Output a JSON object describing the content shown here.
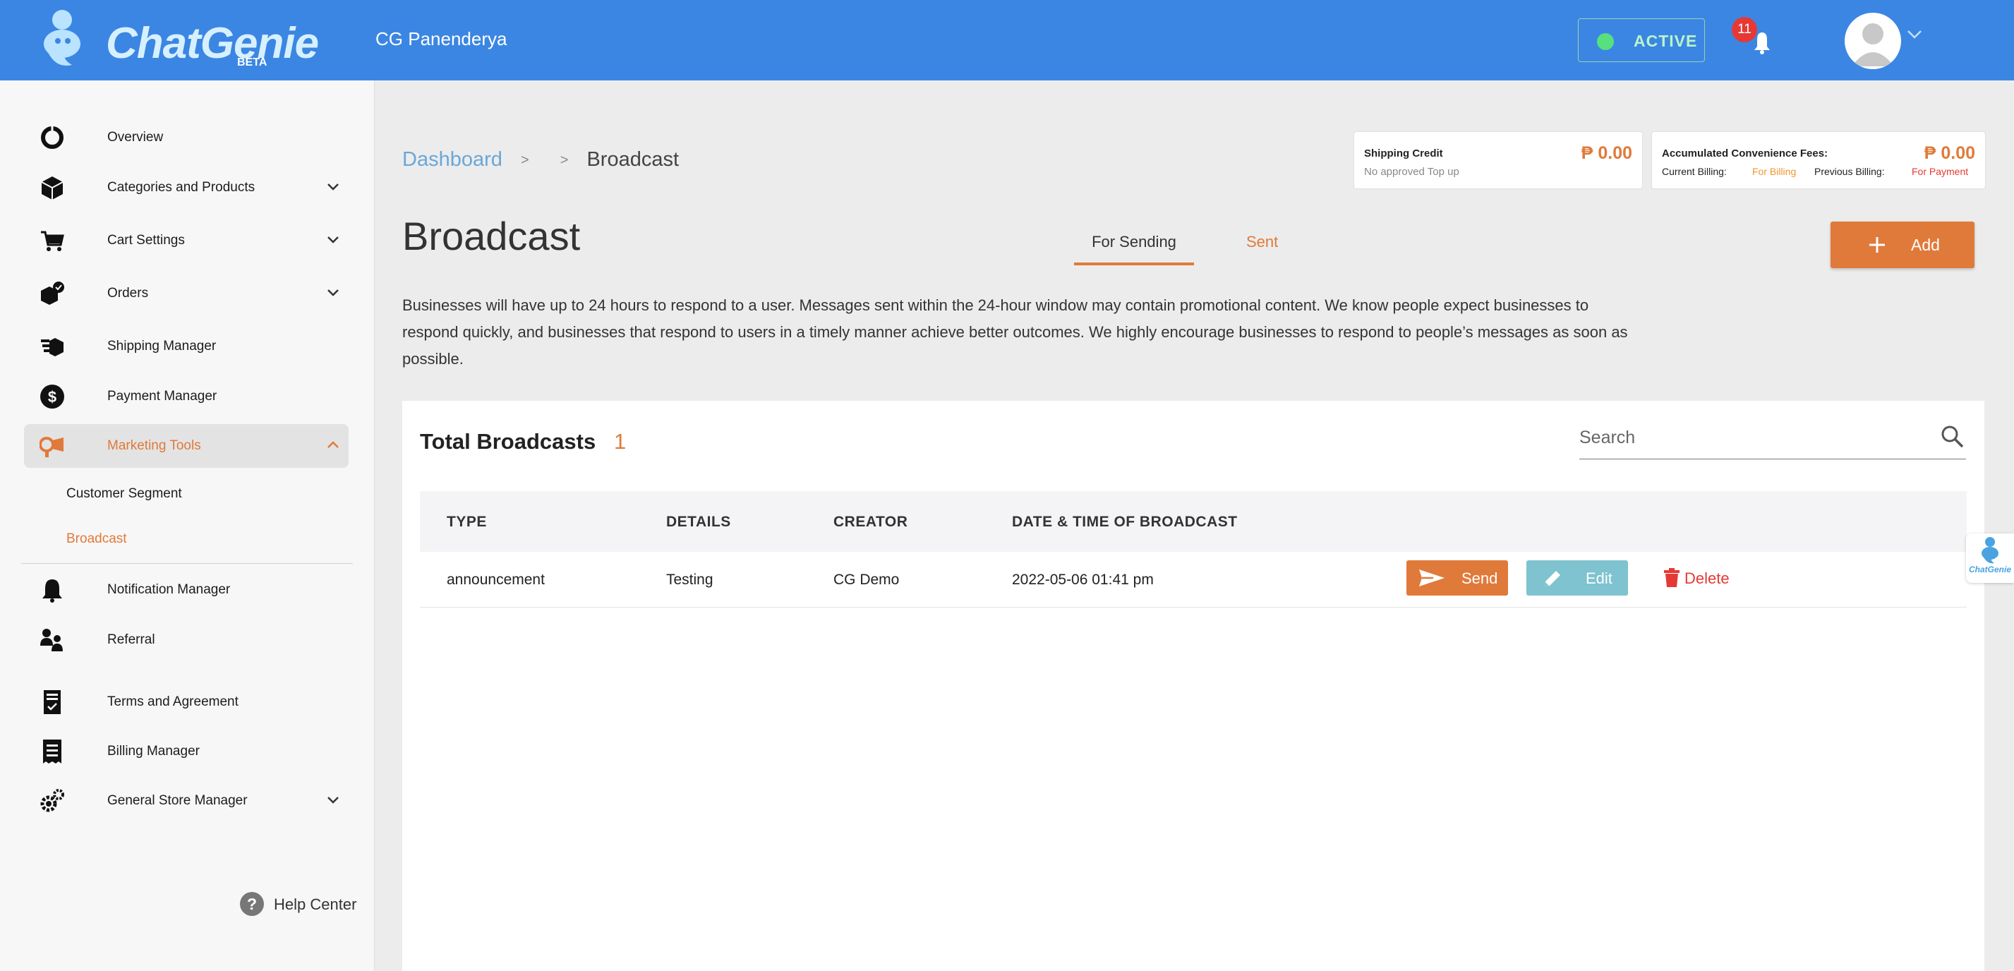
{
  "brand": {
    "name": "ChatGenie",
    "beta": "BETA"
  },
  "header": {
    "store_name": "CG Panenderya",
    "status": "ACTIVE",
    "notification_count": "11"
  },
  "sidebar": {
    "items": [
      {
        "label": "Overview",
        "icon": "donut-icon"
      },
      {
        "label": "Categories and Products",
        "icon": "box-icon"
      },
      {
        "label": "Cart Settings",
        "icon": "cart-icon"
      },
      {
        "label": "Orders",
        "icon": "orders-icon"
      },
      {
        "label": "Shipping Manager",
        "icon": "shipping-icon"
      },
      {
        "label": "Payment Manager",
        "icon": "dollar-icon"
      },
      {
        "label": "Marketing Tools",
        "icon": "megaphone-icon"
      },
      {
        "label": "Notification Manager",
        "icon": "bell-icon"
      },
      {
        "label": "Referral",
        "icon": "referral-icon"
      },
      {
        "label": "Terms and Agreement",
        "icon": "document-icon"
      },
      {
        "label": "Billing Manager",
        "icon": "receipt-icon"
      },
      {
        "label": "General Store Manager",
        "icon": "settings-icon"
      }
    ],
    "subitems": [
      {
        "label": "Customer Segment"
      },
      {
        "label": "Broadcast"
      }
    ],
    "help": "Help Center"
  },
  "breadcrumb": {
    "parent": "Dashboard",
    "separator": ">",
    "current": "Broadcast"
  },
  "shipping_credit": {
    "title": "Shipping Credit",
    "amount": "₱ 0.00",
    "note": "No approved Top up"
  },
  "fees": {
    "title": "Accumulated Convenience Fees:",
    "amount": "₱ 0.00",
    "current_label": "Current Billing:",
    "current_value": "For Billing",
    "previous_label": "Previous Billing:",
    "previous_value": "For Payment"
  },
  "page": {
    "title": "Broadcast",
    "tabs": [
      "For Sending",
      "Sent"
    ],
    "add_label": "Add",
    "intro": "Businesses will have up to 24 hours to respond to a user. Messages sent within the 24-hour window may contain promotional content. We know people expect businesses to respond quickly, and businesses that respond to users in a timely manner achieve better outcomes. We highly encourage businesses to respond to people’s messages as soon as possible."
  },
  "table": {
    "total_label": "Total Broadcasts",
    "total_count": "1",
    "search_placeholder": "Search",
    "columns": [
      "TYPE",
      "DETAILS",
      "CREATOR",
      "DATE & TIME OF BROADCAST"
    ],
    "rows": [
      {
        "type": "announcement",
        "details": "Testing",
        "creator": "CG Demo",
        "datetime": "2022-05-06 01:41 pm"
      }
    ],
    "actions": {
      "send": "Send",
      "edit": "Edit",
      "delete": "Delete"
    }
  },
  "colors": {
    "topbar": "#3b86e3",
    "accent": "#e07a3a",
    "edit": "#7ec3cf",
    "danger": "#e53935",
    "active_green": "#57e07e"
  }
}
